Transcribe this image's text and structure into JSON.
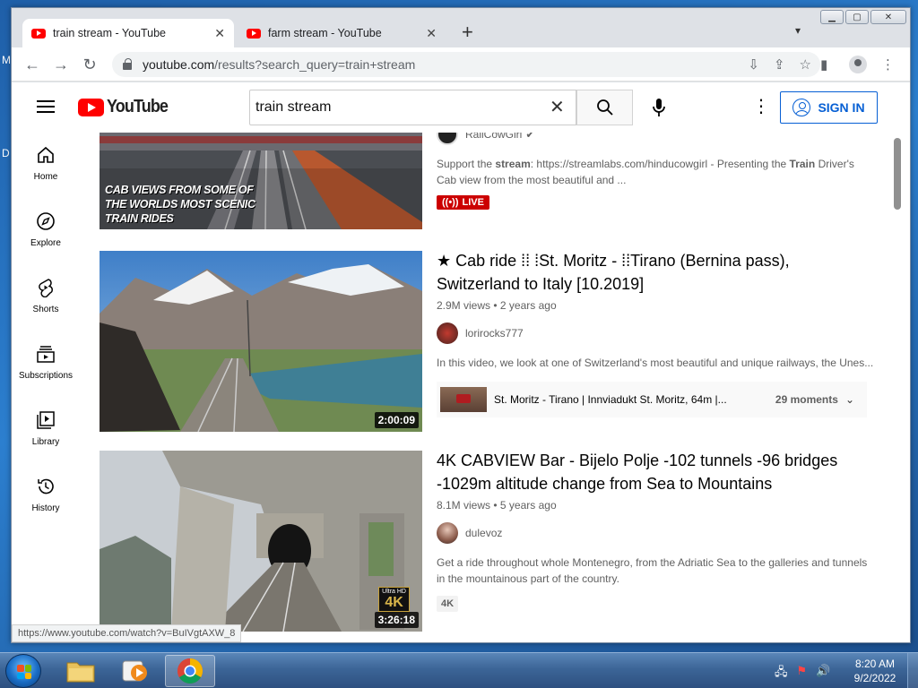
{
  "desktop": {
    "letters": [
      "M",
      "D"
    ]
  },
  "browser": {
    "tabs": [
      {
        "title": "train stream - YouTube",
        "active": true
      },
      {
        "title": "farm stream - YouTube",
        "active": false
      }
    ],
    "new_tab": "+",
    "url": {
      "host": "youtube.com",
      "rest": "/results?search_query=train+stream"
    },
    "status_url": "https://www.youtube.com/watch?v=BuIVgtAXW_8"
  },
  "youtube": {
    "logo_text": "YouTube",
    "search_value": "train stream",
    "sign_in": "SIGN IN",
    "guide": [
      {
        "label": "Home",
        "icon": "home-icon"
      },
      {
        "label": "Explore",
        "icon": "compass-icon"
      },
      {
        "label": "Shorts",
        "icon": "shorts-icon"
      },
      {
        "label": "Subscriptions",
        "icon": "subscriptions-icon"
      },
      {
        "label": "Library",
        "icon": "library-icon"
      },
      {
        "label": "History",
        "icon": "history-icon"
      }
    ],
    "results": [
      {
        "thumb_caption": [
          "CAB VIEWS FROM SOME OF",
          "THE WORLDS MOST SCENIC",
          "TRAIN RIDES"
        ],
        "channel": "RailCowGirl",
        "desc_html_parts": [
          "Support the ",
          "stream",
          ": https://streamlabs.com/hinducowgirl - Presenting the ",
          "Train",
          " Driver's Cab view from the most beautiful and ..."
        ],
        "live": "LIVE"
      },
      {
        "title": "★ Cab ride ⁞⁞ ⁞St. Moritz - ⁞⁞Tirano (Bernina pass), Switzerland to Italy [10.2019]",
        "views": "2.9M views",
        "age": "2 years ago",
        "channel": "lorirocks777",
        "desc": "In this video, we look at one of Switzerland's most beautiful and unique railways, the Unes...",
        "duration": "2:00:09",
        "moment_title": "St. Moritz - Tirano | Innviadukt St. Moritz, 64m |...",
        "moment_count": "29 moments"
      },
      {
        "title": "4K CABVIEW Bar - Bijelo Polje -102 tunnels -96 bridges -1029m altitude change from Sea to Mountains",
        "views": "8.1M views",
        "age": "5 years ago",
        "channel": "dulevoz",
        "desc": "Get a ride throughout whole Montenegro, from the Adriatic Sea to the galleries and tunnels in the mountainous part of the country.",
        "duration": "3:26:18",
        "badge": "4K",
        "uhd_top": "Ultra HD",
        "uhd_main": "4K"
      }
    ]
  },
  "taskbar": {
    "time": "8:20 AM",
    "date": "9/2/2022"
  },
  "colors": {
    "yt_red": "#ff0000",
    "link_blue": "#065fd4",
    "live_red": "#cc0000"
  }
}
